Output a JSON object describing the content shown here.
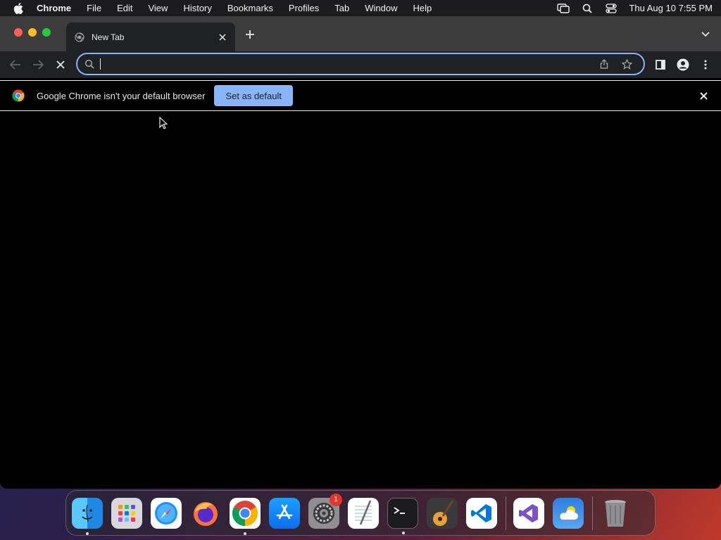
{
  "menubar": {
    "app_name": "Chrome",
    "items": [
      "File",
      "Edit",
      "View",
      "History",
      "Bookmarks",
      "Profiles",
      "Tab",
      "Window",
      "Help"
    ],
    "clock": "Thu Aug 10  7:55 PM",
    "icons": [
      "screen-mirroring-icon",
      "spotlight-search-icon",
      "control-center-icon"
    ]
  },
  "browser": {
    "tab": {
      "title": "New Tab"
    },
    "omnibox": {
      "value": "",
      "placeholder": ""
    },
    "infobar": {
      "message": "Google Chrome isn't your default browser",
      "button_label": "Set as default"
    },
    "accent_color": "#8ab4f8"
  },
  "dock": {
    "apps": [
      {
        "name": "finder",
        "running": true
      },
      {
        "name": "launchpad",
        "running": false
      },
      {
        "name": "safari",
        "running": false
      },
      {
        "name": "firefox",
        "running": false
      },
      {
        "name": "chrome",
        "running": true
      },
      {
        "name": "app-store",
        "running": false
      },
      {
        "name": "system-settings",
        "running": false,
        "badge": "1"
      },
      {
        "name": "textedit",
        "running": false
      },
      {
        "name": "terminal",
        "running": true
      },
      {
        "name": "garageband",
        "running": false
      },
      {
        "name": "vscode",
        "running": false
      },
      {
        "name": "visual-studio",
        "running": false
      },
      {
        "name": "weather",
        "running": false
      },
      {
        "name": "trash",
        "running": false
      }
    ]
  }
}
